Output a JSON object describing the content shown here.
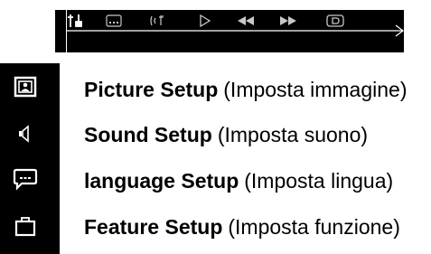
{
  "toolbar": {
    "icons": [
      "settings-icon",
      "subtitle-icon",
      "audio-icon",
      "play-icon",
      "rewind-icon",
      "fast-forward-icon",
      "display-icon"
    ],
    "active_icon": "settings-icon"
  },
  "menu": {
    "items": [
      {
        "title": "Picture Setup",
        "subtitle": "(Imposta immagine)",
        "icon": "picture-icon"
      },
      {
        "title": "Sound Setup",
        "subtitle": "(Imposta suono)",
        "icon": "speaker-icon"
      },
      {
        "title": "language Setup",
        "subtitle": "(Imposta lingua)",
        "icon": "speech-bubble-icon"
      },
      {
        "title": "Feature Setup",
        "subtitle": "(Imposta funzione)",
        "icon": "briefcase-icon"
      }
    ]
  },
  "colors": {
    "background": "#ffffff",
    "bar": "#000000",
    "icon_active": "#ffffff",
    "icon_inactive": "#c8c8c8",
    "text": "#000000"
  }
}
